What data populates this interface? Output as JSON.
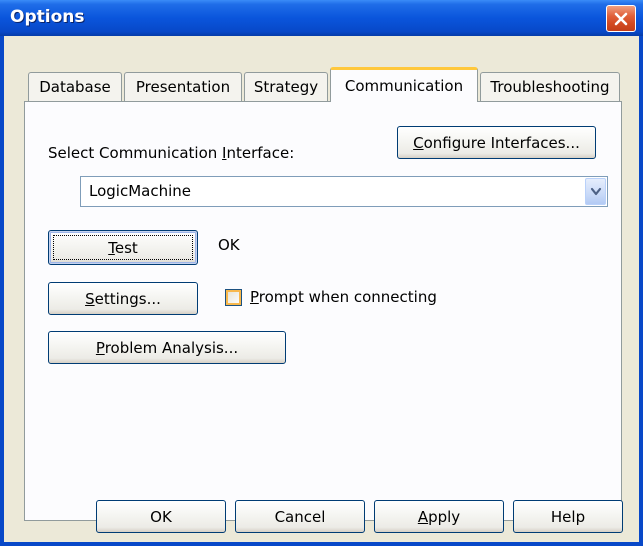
{
  "window": {
    "title": "Options"
  },
  "tabs": [
    {
      "label": "Database",
      "active": false
    },
    {
      "label": "Presentation",
      "active": false
    },
    {
      "label": "Strategy",
      "active": false
    },
    {
      "label": "Communication",
      "active": true
    },
    {
      "label": "Troubleshooting",
      "active": false
    }
  ],
  "communication": {
    "interface_label_pre": "Select Communication ",
    "interface_label_ul": "I",
    "interface_label_post": "nterface:",
    "configure_pre": "",
    "configure_ul": "C",
    "configure_post": "onfigure Interfaces...",
    "interface_value": "LogicMachine",
    "test_ul": "T",
    "test_post": "est",
    "test_result": "OK",
    "settings_ul": "S",
    "settings_post": "ettings...",
    "prompt_ul": "P",
    "prompt_post": "rompt when connecting",
    "prompt_checked": false,
    "problem_ul": "P",
    "problem_post": "roblem Analysis..."
  },
  "footer": {
    "ok": "OK",
    "cancel": "Cancel",
    "apply_ul": "A",
    "apply_post": "pply",
    "help": "Help"
  }
}
